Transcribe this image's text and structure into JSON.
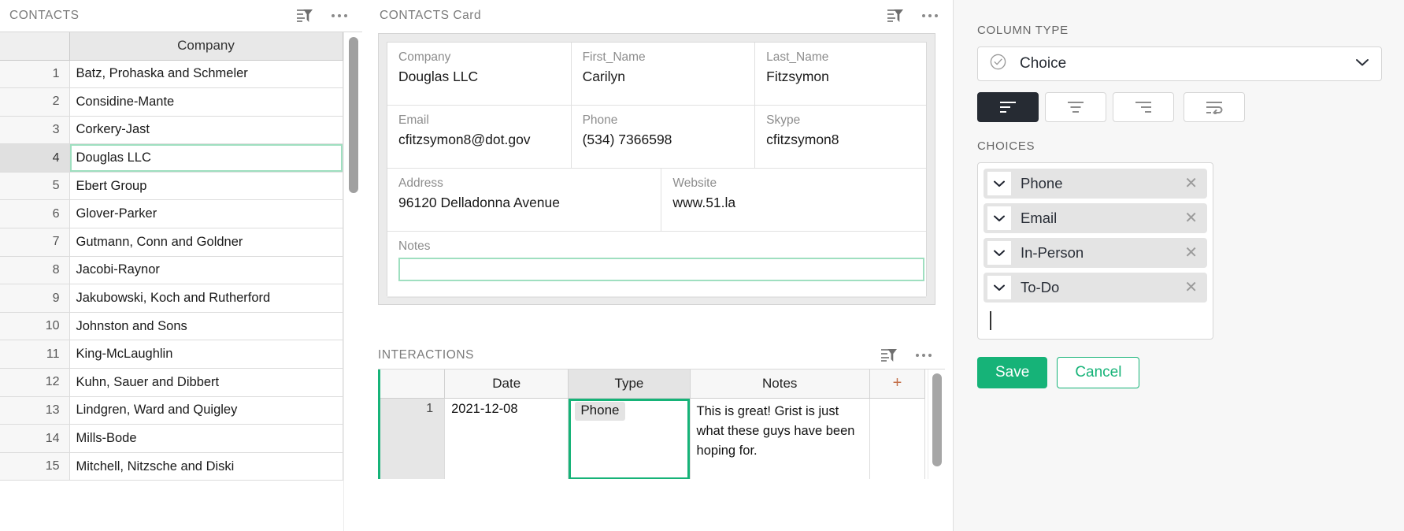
{
  "contacts_pane": {
    "title": "CONTACTS",
    "icons": {
      "filter": "filter-sort-icon",
      "menu": "more-options-icon"
    },
    "columns": [
      "",
      "Company"
    ],
    "rows": [
      {
        "num": "1",
        "company": "Batz, Prohaska and Schmeler"
      },
      {
        "num": "2",
        "company": "Considine-Mante"
      },
      {
        "num": "3",
        "company": "Corkery-Jast"
      },
      {
        "num": "4",
        "company": "Douglas LLC"
      },
      {
        "num": "5",
        "company": "Ebert Group"
      },
      {
        "num": "6",
        "company": "Glover-Parker"
      },
      {
        "num": "7",
        "company": "Gutmann, Conn and Goldner"
      },
      {
        "num": "8",
        "company": "Jacobi-Raynor"
      },
      {
        "num": "9",
        "company": "Jakubowski, Koch and Rutherford"
      },
      {
        "num": "10",
        "company": "Johnston and Sons"
      },
      {
        "num": "11",
        "company": "King-McLaughlin"
      },
      {
        "num": "12",
        "company": "Kuhn, Sauer and Dibbert"
      },
      {
        "num": "13",
        "company": "Lindgren, Ward and Quigley"
      },
      {
        "num": "14",
        "company": "Mills-Bode"
      },
      {
        "num": "15",
        "company": "Mitchell, Nitzsche and Diski"
      }
    ],
    "selected_row": 4
  },
  "card_pane": {
    "title": "CONTACTS Card",
    "icons": {
      "filter": "filter-sort-icon",
      "menu": "more-options-icon"
    },
    "fields": [
      {
        "label": "Company",
        "value": "Douglas LLC"
      },
      {
        "label": "First_Name",
        "value": "Carilyn"
      },
      {
        "label": "Last_Name",
        "value": "Fitzsymon"
      },
      {
        "label": "Email",
        "value": "cfitzsymon8@dot.gov"
      },
      {
        "label": "Phone",
        "value": "(534) 7366598"
      },
      {
        "label": "Skype",
        "value": "cfitzsymon8"
      },
      {
        "label": "Address",
        "value": "96120 Delladonna Avenue"
      },
      {
        "label": "Website",
        "value": "www.51.la"
      }
    ],
    "notes": {
      "label": "Notes",
      "value": ""
    }
  },
  "interactions_pane": {
    "title": "INTERACTIONS",
    "icons": {
      "filter": "filter-sort-icon",
      "menu": "more-options-icon"
    },
    "columns": [
      "",
      "Date",
      "Type",
      "Notes",
      "+"
    ],
    "rows": [
      {
        "num": "1",
        "date": "2021-12-08",
        "type": "Phone",
        "notes": "This is great! Grist is just what these guys have been hoping for."
      }
    ],
    "selected_cell": "Type"
  },
  "creator_panel": {
    "column_type_label": "COLUMN TYPE",
    "column_type_value": "Choice",
    "column_type_icon": "choice-check-icon",
    "dropdown_icon": "chevron-down-icon",
    "alignment": {
      "options": [
        {
          "name": "align-left",
          "icon": "align-left-icon",
          "active": true
        },
        {
          "name": "align-center",
          "icon": "align-center-icon",
          "active": false
        },
        {
          "name": "align-right",
          "icon": "align-right-icon",
          "active": false
        },
        {
          "name": "wrap-text",
          "icon": "wrap-text-icon",
          "active": false
        }
      ]
    },
    "choices_label": "CHOICES",
    "choices": [
      {
        "label": "Phone"
      },
      {
        "label": "Email"
      },
      {
        "label": "In-Person"
      },
      {
        "label": "To-Do"
      }
    ],
    "new_choice_value": "",
    "save_label": "Save",
    "cancel_label": "Cancel",
    "colors": {
      "accent_green": "#16b378",
      "selection_mint": "#9fdfc0",
      "dark_active": "#262b33"
    }
  }
}
